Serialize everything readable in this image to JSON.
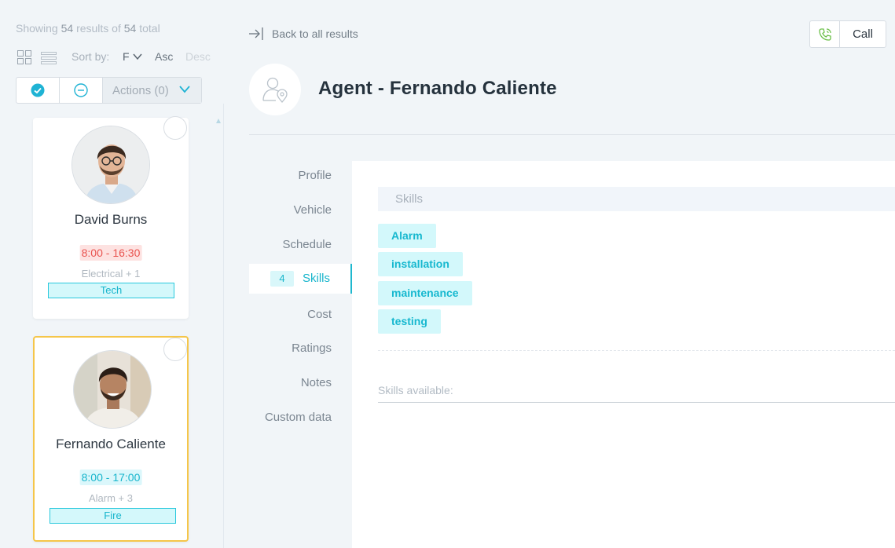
{
  "results": {
    "prefix": "Showing",
    "shown": "54",
    "middle": "results of",
    "total": "54",
    "suffix": "total"
  },
  "toolbar": {
    "sort_label": "Sort by:",
    "sort_field": "F",
    "sort_asc": "Asc",
    "sort_desc": "Desc",
    "actions_label": "Actions (0)"
  },
  "cards": [
    {
      "name": "David Burns",
      "time": "8:00 - 16:30",
      "time_status": "late",
      "skills_summary": "Electrical + 1",
      "group": "Tech"
    },
    {
      "name": "Fernando Caliente",
      "time": "8:00 - 17:00",
      "time_status": "on-time",
      "skills_summary": "Alarm + 3",
      "group": "Fire",
      "selected": true
    }
  ],
  "header": {
    "back_label": "Back to all results",
    "call_label": "Call",
    "title": "Agent - Fernando Caliente"
  },
  "nav": {
    "items": [
      "Profile",
      "Vehicle",
      "Schedule",
      "Skills",
      "Cost",
      "Ratings",
      "Notes",
      "Custom data"
    ],
    "active": "Skills",
    "active_count": "4"
  },
  "skills": {
    "header": "Skills",
    "tags": [
      "Alarm",
      "installation",
      "maintenance",
      "testing"
    ],
    "available_placeholder": "Skills available:"
  },
  "colors": {
    "accent": "#17b5cc",
    "late": "#e9534f",
    "selected_border": "#f5c64a",
    "call_icon": "#6cc04a"
  }
}
